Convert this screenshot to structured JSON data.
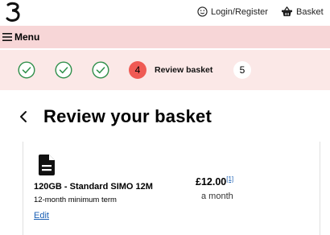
{
  "header": {
    "logo_icon": "three-logo",
    "account_icon": "smiley-user-icon",
    "account_label": "Login/Register",
    "basket_icon": "basket-icon",
    "basket_label": "Basket"
  },
  "menu": {
    "icon": "hamburger-icon",
    "label": "Menu"
  },
  "progress": {
    "completed_steps": 3,
    "current_step": "4",
    "current_label": "Review basket",
    "next_step": "5",
    "accent_color": "#ef5a54",
    "done_color": "#2f8f4a"
  },
  "page": {
    "back_icon": "chevron-left-icon",
    "title": "Review your basket"
  },
  "basket_item": {
    "icon": "document-icon",
    "name": "120GB - Standard SIMO 12M",
    "term": "12-month minimum term",
    "edit_label": "Edit",
    "price": "£12.00",
    "price_reference": "[1]",
    "price_period": "a month"
  }
}
